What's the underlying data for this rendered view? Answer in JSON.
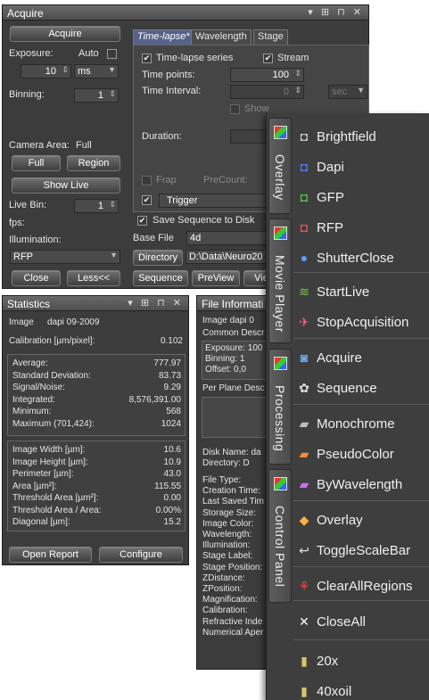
{
  "acquire": {
    "title": "Acquire",
    "acquire_btn": "Acquire",
    "exposure_label": "Exposure:",
    "auto_label": "Auto",
    "exposure_value": "10",
    "exposure_unit": "ms",
    "binning_label": "Binning:",
    "binning_value": "1",
    "camera_area_label": "Camera Area:",
    "camera_area_value": "Full",
    "full_btn": "Full",
    "region_btn": "Region",
    "show_live_btn": "Show Live",
    "live_bin_label": "Live Bin:",
    "live_bin_value": "1",
    "fps_label": "fps:",
    "illumination_label": "Illumination:",
    "illumination_value": "RFP",
    "close_btn": "Close",
    "less_btn": "Less<<",
    "tabs": [
      "Time-lapse*",
      "Wavelength",
      "Stage"
    ],
    "timelapse_series": "Time-lapse series",
    "stream": "Stream",
    "time_points_label": "Time points:",
    "time_points_value": "100",
    "time_interval_label": "Time Interval:",
    "time_interval_value": "0",
    "time_interval_unit": "sec",
    "show_label": "Show",
    "duration_label": "Duration:",
    "frap_label": "Frap",
    "precount_label": "PreCount:",
    "trigger_value": "Trigger",
    "save_sequence": "Save Sequence to Disk",
    "base_file_label": "Base File",
    "base_file_value": "4d",
    "directory_btn": "Directory",
    "directory_value": "D:\\Data\\Neuro20",
    "sequence_btn": "Sequence",
    "preview_btn": "PreView",
    "view_btn": "Vie"
  },
  "statistics": {
    "title": "Statistics",
    "image_label": "Image",
    "image_value": "dapi 09-2009",
    "calibration_label": "Calibration [µm/pixel]:",
    "calibration_value": "0.102",
    "rows1": [
      {
        "label": "Average:",
        "value": "777.97"
      },
      {
        "label": "Standard Deviation:",
        "value": "83.73"
      },
      {
        "label": "Signal/Noise:",
        "value": "9.29"
      },
      {
        "label": "Integrated:",
        "value": "8,576,391.00"
      },
      {
        "label": "Minimum:",
        "value": "568"
      },
      {
        "label": "Maximum  (701,424):",
        "value": "1024"
      }
    ],
    "rows2": [
      {
        "label": "Image Width [µm]:",
        "value": "10.6"
      },
      {
        "label": "Image Height [µm]:",
        "value": "10.9"
      },
      {
        "label": "Perimeter [µm]:",
        "value": "43.0"
      },
      {
        "label": "Area [µm²]:",
        "value": "115.55"
      },
      {
        "label": "Threshold Area [µm²]:",
        "value": "0.00"
      },
      {
        "label": "Threshold Area / Area:",
        "value": "0.00%"
      },
      {
        "label": "Diagonal [µm]:",
        "value": "15.2"
      }
    ],
    "open_report_btn": "Open Report",
    "configure_btn": "Configure"
  },
  "fileinfo": {
    "title": "File Informati",
    "image_line": "Image   dapi 0",
    "common_desc": "Common Descr",
    "desc_lines": [
      "Exposure: 100",
      "Binning: 1",
      "Offset: 0,0"
    ],
    "per_plane": "Per Plane Desc",
    "disk_name": "Disk Name:  da",
    "directory": "Directory:    D",
    "fields": [
      "File Type:",
      "Creation Time:",
      "Last Saved Tim",
      "Storage Size:",
      "Image Color:",
      "Wavelength:",
      "Illumination:",
      "Stage Label:",
      "Stage Position:",
      "ZDistance:",
      "ZPosition:",
      "Magnification:",
      "Calibration:",
      "Refractive Inde",
      "Numerical Aper"
    ]
  },
  "toolbox": {
    "tabs": [
      "Overlay",
      "Movie Player",
      "Processing",
      "Control Panel"
    ],
    "items": [
      {
        "label": "Brightfield",
        "icon": "camera-icon",
        "glyph": "◘",
        "color": "#cfcfcf"
      },
      {
        "label": "Dapi",
        "icon": "camera-blue-icon",
        "glyph": "◘",
        "color": "#4f7fff"
      },
      {
        "label": "GFP",
        "icon": "camera-green-icon",
        "glyph": "◘",
        "color": "#47d147"
      },
      {
        "label": "RFP",
        "icon": "camera-red-icon",
        "glyph": "◘",
        "color": "#ff4d4d"
      },
      {
        "label": "ShutterClose",
        "icon": "shutter-icon",
        "glyph": "●",
        "color": "#5aa0ff"
      },
      {
        "label": "StartLive",
        "icon": "start-live-icon",
        "glyph": "≋",
        "color": "#7cd04a"
      },
      {
        "label": "StopAcquisition",
        "icon": "stop-acquisition-icon",
        "glyph": "✈",
        "color": "#ff5a7a"
      },
      {
        "label": "Acquire",
        "icon": "acquire-camera-icon",
        "glyph": "◙",
        "color": "#6ab0ff"
      },
      {
        "label": "Sequence",
        "icon": "sequence-icon",
        "glyph": "✿",
        "color": "#e0e0e0"
      },
      {
        "label": "Monochrome",
        "icon": "monochrome-icon",
        "glyph": "▰",
        "color": "#bdbdbd"
      },
      {
        "label": "PseudoColor",
        "icon": "pseudocolor-icon",
        "glyph": "▰",
        "color": "#ff8a3d"
      },
      {
        "label": "ByWavelength",
        "icon": "bywavelength-icon",
        "glyph": "▰",
        "color": "#c86bff"
      },
      {
        "label": "Overlay",
        "icon": "overlay-icon",
        "glyph": "◆",
        "color": "#ffb040"
      },
      {
        "label": "ToggleScaleBar",
        "icon": "scalebar-icon",
        "glyph": "↩",
        "color": "#e0e0e0"
      },
      {
        "label": "ClearAllRegions",
        "icon": "clear-regions-icon",
        "glyph": "⚘",
        "color": "#ff4040"
      },
      {
        "label": "CloseAll",
        "icon": "close-all-icon",
        "glyph": "✕",
        "color": "#ffffff"
      },
      {
        "label": "20x",
        "icon": "objective-20x-icon",
        "glyph": "▮",
        "color": "#d8c36a"
      },
      {
        "label": "40xoil",
        "icon": "objective-40x-icon",
        "glyph": "▮",
        "color": "#d8c36a"
      }
    ]
  }
}
